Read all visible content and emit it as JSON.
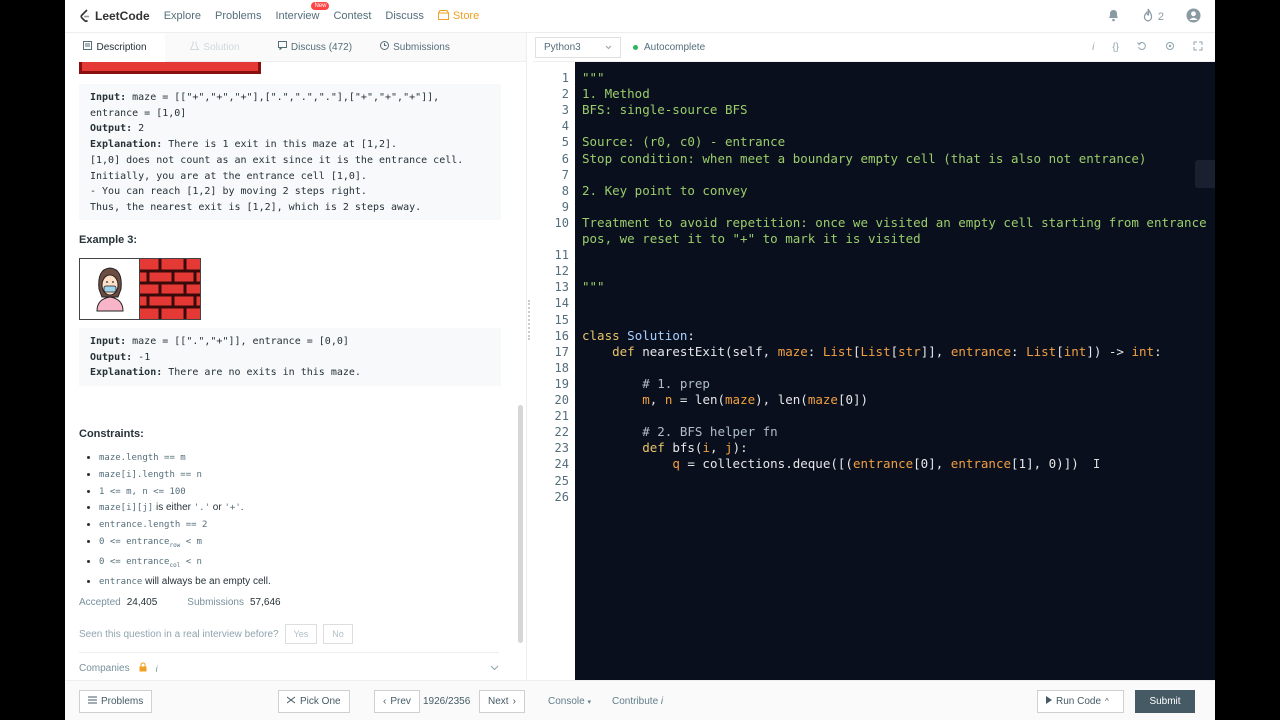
{
  "nav": {
    "brand": "LeetCode",
    "items": [
      "Explore",
      "Problems",
      "Interview",
      "Contest",
      "Discuss"
    ],
    "interview_badge": "New",
    "store": "Store",
    "streak_count": "2"
  },
  "tabs": [
    {
      "label": "Description",
      "icon": "doc-icon"
    },
    {
      "label": "Solution",
      "icon": "flask-icon"
    },
    {
      "label": "Discuss (472)",
      "icon": "chat-icon"
    },
    {
      "label": "Submissions",
      "icon": "history-icon"
    }
  ],
  "example2": {
    "input_label": "Input:",
    "input_value": " maze = [[\"+\",\"+\",\"+\"],[\".\",\".\",\".\"],[\"+\",\"+\",\"+\"]], entrance = [1,0]",
    "output_label": "Output:",
    "output_value": " 2",
    "explanation_label": "Explanation:",
    "explanation_lines": [
      " There is 1 exit in this maze at [1,2].",
      "[1,0] does not count as an exit since it is the entrance cell.",
      "Initially, you are at the entrance cell [1,0].",
      "- You can reach [1,2] by moving 2 steps right.",
      "Thus, the nearest exit is [1,2], which is 2 steps away."
    ]
  },
  "example3": {
    "title": "Example 3:",
    "input_label": "Input:",
    "input_value": " maze = [[\".\",\"+\"]], entrance = [0,0]",
    "output_label": "Output:",
    "output_value": " -1",
    "explanation_label": "Explanation:",
    "explanation_value": " There are no exits in this maze."
  },
  "constraints": {
    "title": "Constraints:",
    "items": [
      {
        "code": "maze.length == m",
        "text": ""
      },
      {
        "code": "maze[i].length == n",
        "text": ""
      },
      {
        "code": "1 <= m, n <= 100",
        "text": ""
      },
      {
        "code": "maze[i][j]",
        "text": " is either ",
        "code2": "'.'",
        "text2": " or ",
        "code3": "'+'",
        "text3": "."
      },
      {
        "code": "entrance.length == 2",
        "text": ""
      },
      {
        "code": "0 <= entrance",
        "sub": "row",
        "code_after": " < m"
      },
      {
        "code": "0 <= entrance",
        "sub": "col",
        "code_after": " < n"
      },
      {
        "code": "entrance",
        "text": " will always be an empty cell."
      }
    ]
  },
  "stats": {
    "accepted_label": "Accepted",
    "accepted_value": "24,405",
    "submissions_label": "Submissions",
    "submissions_value": "57,646"
  },
  "seen": {
    "question": "Seen this question in a real interview before?",
    "yes": "Yes",
    "no": "No"
  },
  "companies": "Companies",
  "editor": {
    "language": "Python3",
    "autocomplete": "Autocomplete"
  },
  "code_lines": [
    "\"\"\"",
    "1. Method",
    "BFS: single-source BFS",
    "",
    "Source: (r0, c0) - entrance",
    "Stop condition: when meet a boundary empty cell (that is also not entrance)",
    "",
    "2. Key point to convey",
    "",
    "Treatment to avoid repetition: once we visited an empty cell starting from entrance",
    "pos, we reset it to \"+\" to mark it is visited",
    "",
    "",
    "\"\"\"",
    "",
    "",
    "class Solution:",
    "    def nearestExit(self, maze: List[List[str]], entrance: List[int]) -> int:",
    "",
    "        # 1. prep",
    "        m, n = len(maze), len(maze[0])",
    "",
    "        # 2. BFS helper fn",
    "        def bfs(i, j):",
    "            q = collections.deque([(entrance[0], entrance[1], 0)])",
    ""
  ],
  "line_numbers": [
    "1",
    "2",
    "3",
    "4",
    "5",
    "6",
    "7",
    "8",
    "9",
    "10",
    "",
    "11",
    "12",
    "13",
    "14",
    "15",
    "16",
    "17",
    "18",
    "19",
    "20",
    "21",
    "22",
    "23",
    "24",
    "25",
    "26"
  ],
  "bottom": {
    "problems": "Problems",
    "pick_one": "Pick One",
    "prev": "Prev",
    "page": "1926/2356",
    "next": "Next",
    "console": "Console",
    "contribute": "Contribute",
    "run_code": "Run Code",
    "submit": "Submit"
  }
}
